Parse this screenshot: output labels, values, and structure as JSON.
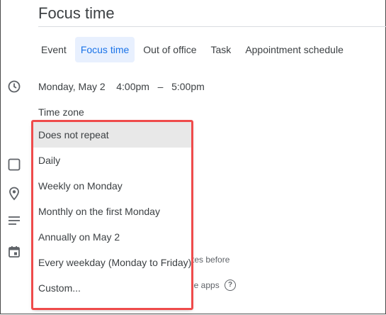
{
  "title": "Focus time",
  "tabs": [
    {
      "label": "Event"
    },
    {
      "label": "Focus time"
    },
    {
      "label": "Out of office"
    },
    {
      "label": "Task"
    },
    {
      "label": "Appointment schedule"
    }
  ],
  "datetime": {
    "date": "Monday, May 2",
    "start": "4:00pm",
    "separator": "–",
    "end": "5:00pm"
  },
  "timezone_label": "Time zone",
  "recurrence_menu": {
    "selected": "Does not repeat",
    "options": [
      "Does not repeat",
      "Daily",
      "Weekly on Monday",
      "Monthly on the first Monday",
      "Annually on May 2",
      "Every weekday (Monday to Friday)",
      "Custom..."
    ]
  },
  "background": {
    "minutes_before_fragment": "tes before",
    "apps_fragment": "le apps",
    "help_glyph": "?"
  },
  "icons": [
    "clock-icon",
    "checkbox-icon",
    "location-pin-icon",
    "description-icon",
    "calendar-icon",
    "help-icon"
  ],
  "colors": {
    "accent": "#1a73e8",
    "active_tab_bg": "#e8f0fe",
    "highlight_border": "#ef4b4b",
    "selected_item_bg": "#e8e8e8"
  }
}
